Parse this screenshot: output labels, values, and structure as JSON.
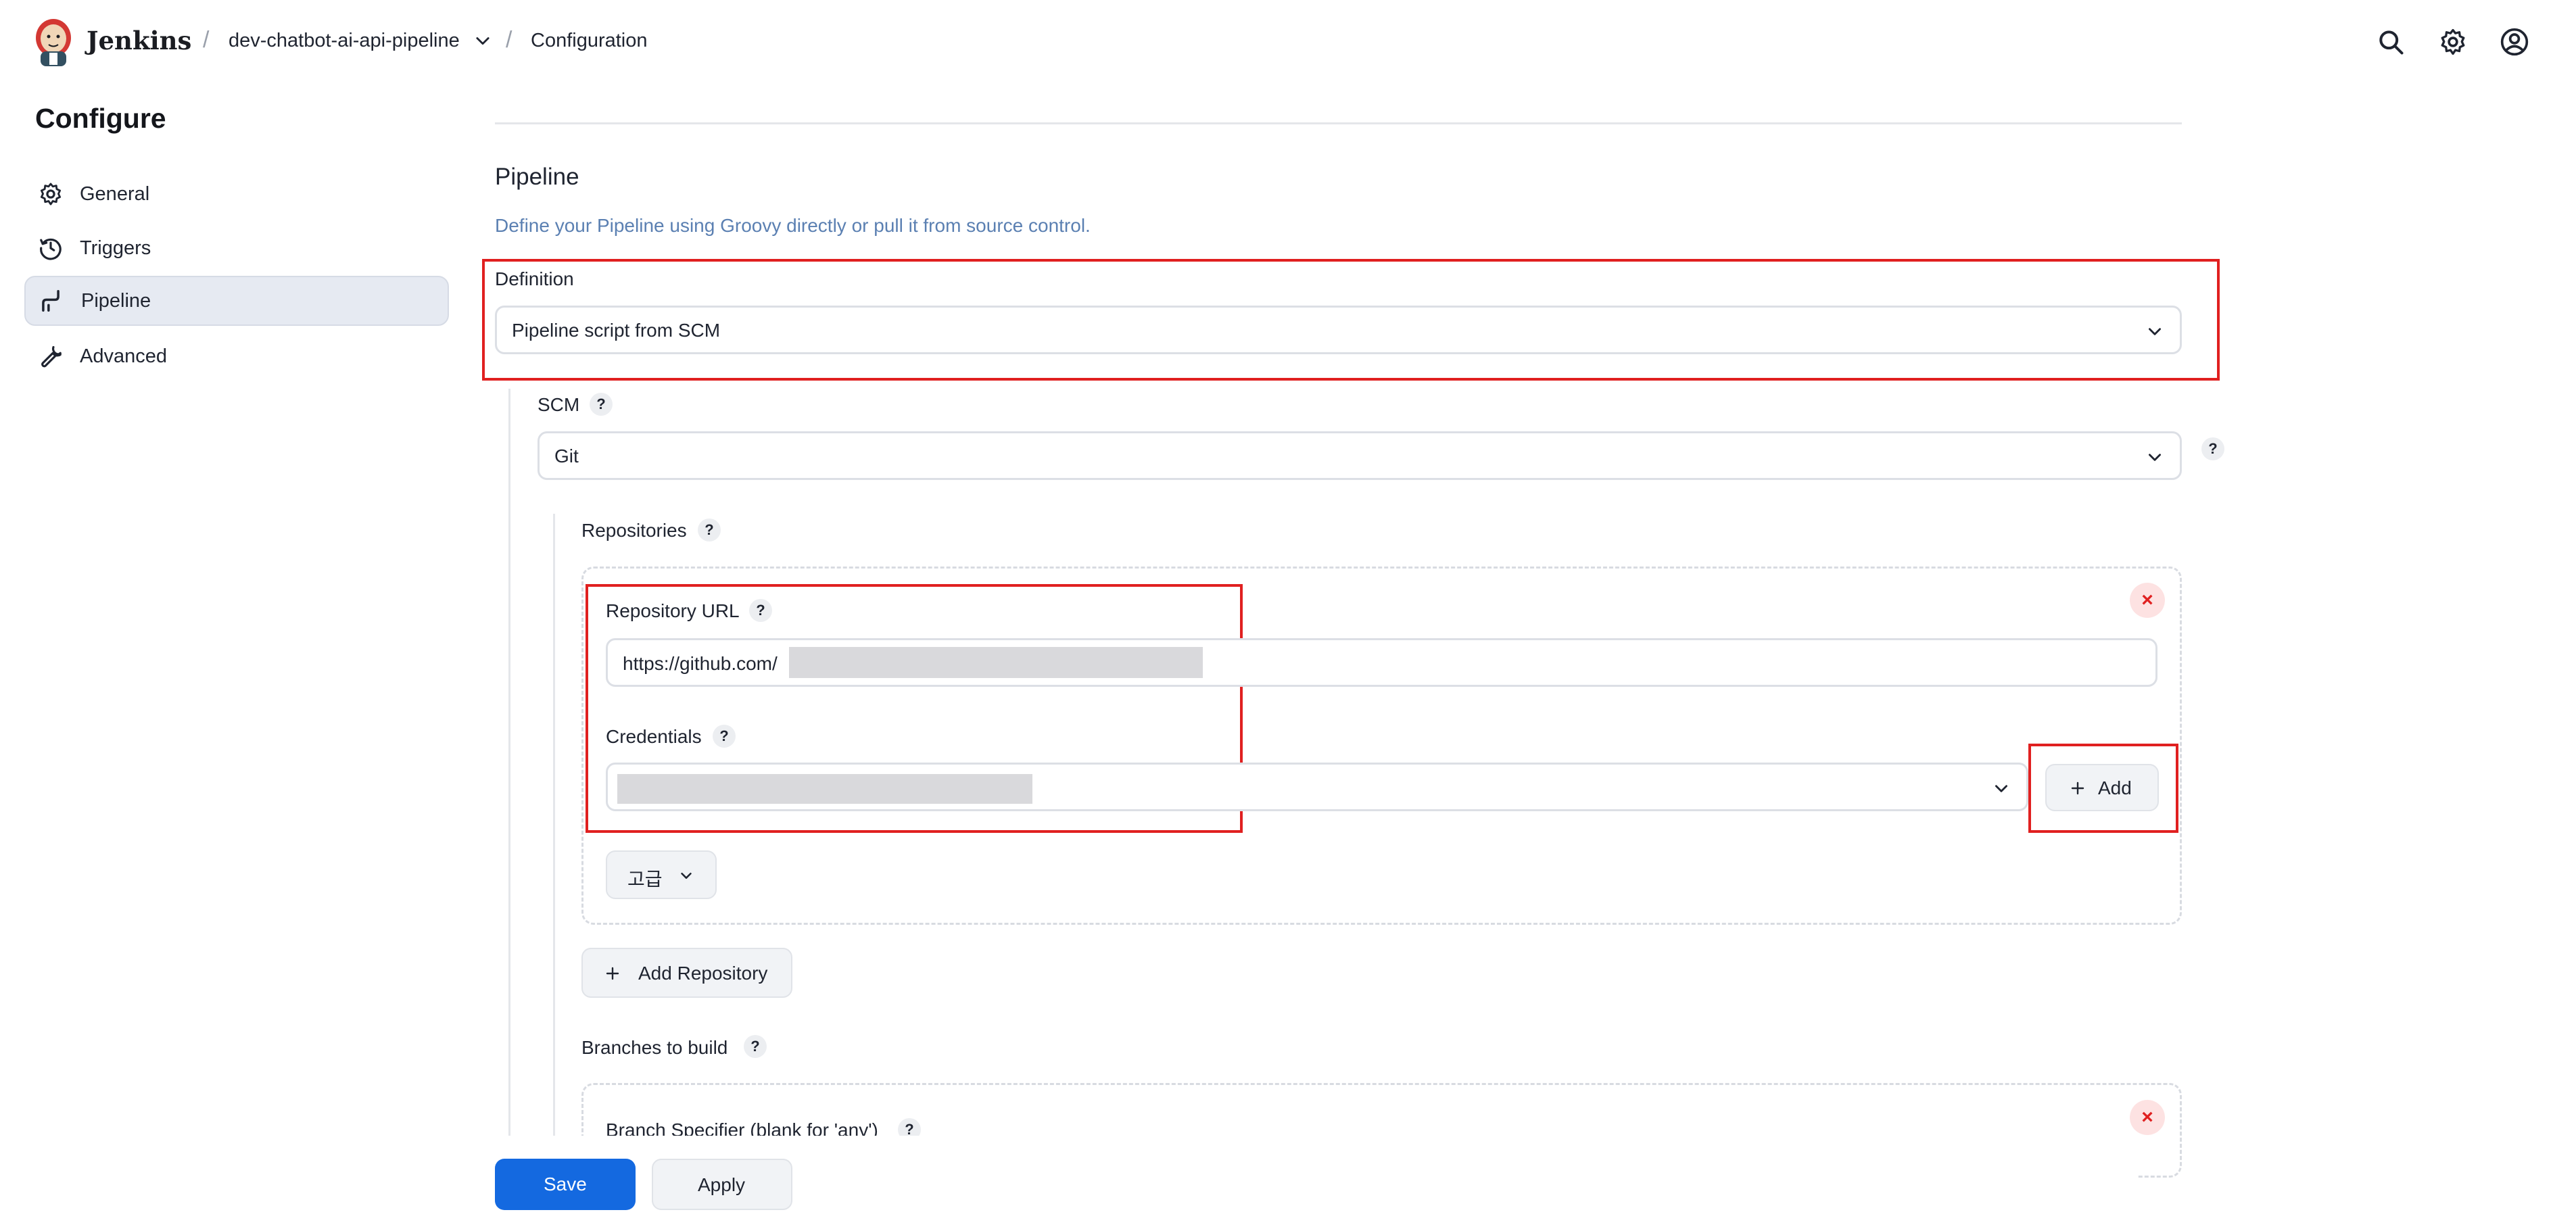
{
  "header": {
    "brand": "Jenkins",
    "breadcrumb_job": "dev-chatbot-ai-api-pipeline",
    "breadcrumb_page": "Configuration",
    "sep": "/"
  },
  "sidebar": {
    "title": "Configure",
    "items": [
      {
        "label": "General",
        "icon": "gear-icon"
      },
      {
        "label": "Triggers",
        "icon": "clock-icon"
      },
      {
        "label": "Pipeline",
        "icon": "pipeline-icon",
        "active": true
      },
      {
        "label": "Advanced",
        "icon": "wrench-icon"
      }
    ]
  },
  "pipeline": {
    "title": "Pipeline",
    "description": "Define your Pipeline using Groovy directly or pull it from source control.",
    "definition_label": "Definition",
    "definition_value": "Pipeline script from SCM",
    "scm_label": "SCM",
    "scm_value": "Git",
    "repositories_label": "Repositories",
    "repo_url_label": "Repository URL",
    "repo_url_value": "https://github.com/",
    "credentials_label": "Credentials",
    "add_label": "Add",
    "advanced_label": "고급",
    "add_repository_label": "Add Repository",
    "branches_label": "Branches to build",
    "branch_specifier_label": "Branch Specifier (blank for 'any')",
    "help": "?",
    "remove": "×"
  },
  "footer": {
    "save_label": "Save",
    "apply_label": "Apply"
  },
  "colors": {
    "accent": "#1469e0",
    "highlight": "#e02020",
    "link": "#5b80b2"
  }
}
